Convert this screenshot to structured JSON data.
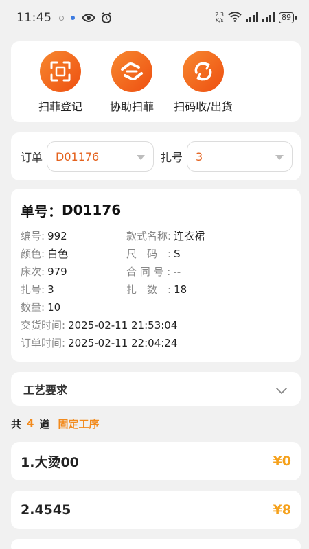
{
  "status_bar": {
    "time": "11:45",
    "net_speed_value": "2.3",
    "net_speed_unit": "K/s",
    "battery": "89"
  },
  "actions": [
    {
      "label": "扫菲登记",
      "icon": "scan-frame-icon"
    },
    {
      "label": "协助扫菲",
      "icon": "handshake-icon"
    },
    {
      "label": "扫码收/出货",
      "icon": "sync-arrows-icon"
    }
  ],
  "selectors": {
    "order_label": "订单",
    "order_value": "D01176",
    "bundle_label": "扎号",
    "bundle_value": "3"
  },
  "detail": {
    "title_prefix": "单号：",
    "title_value": "D01176",
    "fields": {
      "code_key": "编号:",
      "code_val": "992",
      "style_key": "款式名称:",
      "style_val": "连衣裙",
      "color_key": "颜色:",
      "color_val": "白色",
      "size_key": "尺　码　:",
      "size_val": "S",
      "bed_key": "床次:",
      "bed_val": "979",
      "contract_key": "合 同 号 :",
      "contract_val": "--",
      "bundle_key": "扎号:",
      "bundle_val": "3",
      "bundle_count_key": "扎　数　:",
      "bundle_count_val": "18",
      "qty_key": "数量:",
      "qty_val": "10",
      "delivery_key": "交货时间:",
      "delivery_val": "2025-02-11 21:53:04",
      "order_time_key": "订单时间:",
      "order_time_val": "2025-02-11 22:04:24"
    }
  },
  "craft": {
    "label": "工艺要求"
  },
  "summary": {
    "prefix": "共",
    "count": "4",
    "unit": "道",
    "fixed_label": "固定工序"
  },
  "processes": [
    {
      "name": "1.大烫00",
      "price": "¥0"
    },
    {
      "name": "2.4545",
      "price": "¥8"
    }
  ],
  "colors": {
    "accent": "#f28a1c",
    "gradient_start": "#f7882f",
    "gradient_end": "#ee4f11",
    "order_text": "#e4621e"
  }
}
